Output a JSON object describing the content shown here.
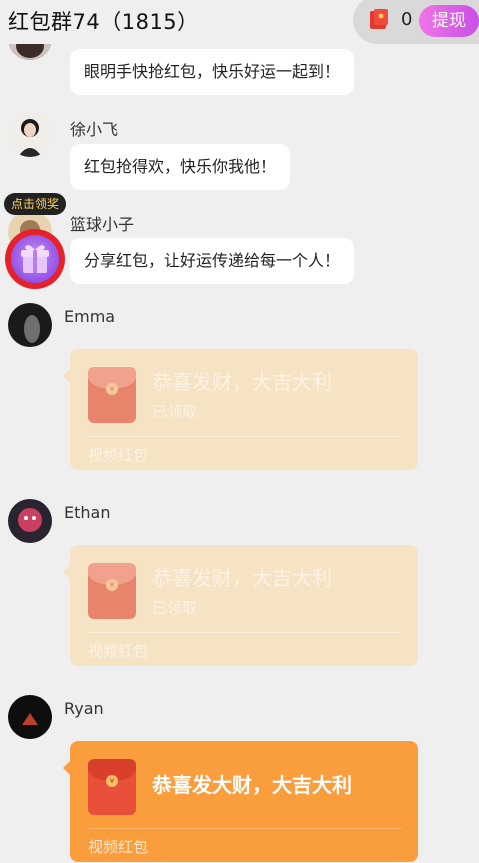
{
  "header": {
    "title": "红包群74（1815）",
    "wallet_count": "0",
    "withdraw_label": "提现"
  },
  "messages": [
    {
      "sender": "",
      "text": "眼明手快抢红包，快乐好运一起到！"
    },
    {
      "sender": "徐小飞",
      "text": "红包抢得欢，快乐你我他！"
    },
    {
      "sender": "篮球小子",
      "text": "分享红包，让好运传递给每一个人！"
    }
  ],
  "floating": {
    "badge_label": "点击领奖"
  },
  "red_packets": [
    {
      "sender": "Emma",
      "title": "恭喜发财，大吉大利",
      "status": "已领取",
      "footer": "视频红包",
      "state": "opened"
    },
    {
      "sender": "Ethan",
      "title": "恭喜发财，大吉大利",
      "status": "已领取",
      "footer": "视频红包",
      "state": "opened"
    },
    {
      "sender": "Ryan",
      "title": "恭喜发大财，大吉大利",
      "footer": "视频红包",
      "state": "unopened"
    }
  ],
  "colors": {
    "opened_packet": "#f6e3c4",
    "active_packet": "#fa9d3c",
    "withdraw_gradient_start": "#f075e8",
    "withdraw_gradient_end": "#c94fe6"
  }
}
